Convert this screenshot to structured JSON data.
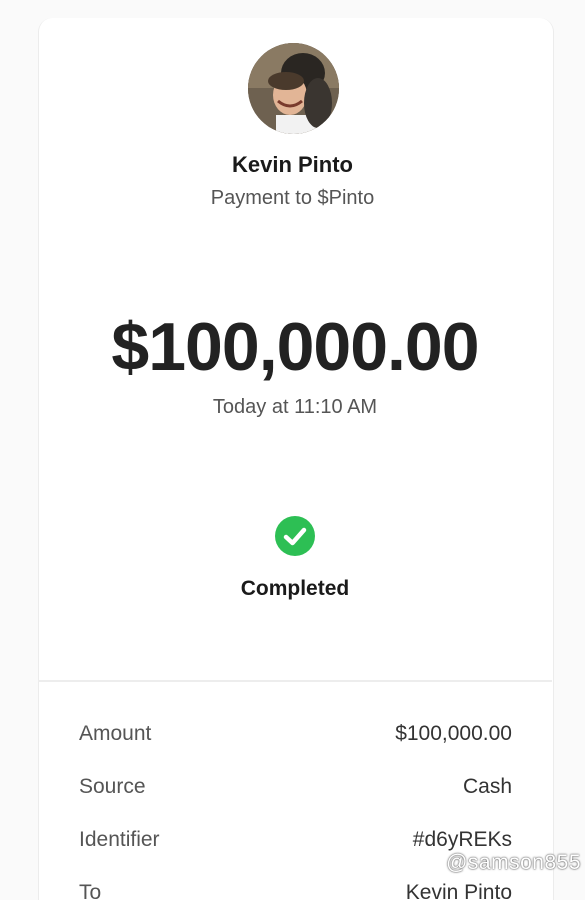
{
  "recipient": {
    "name": "Kevin Pinto",
    "subtitle": "Payment to $Pinto",
    "avatar_icon": "profile-photo"
  },
  "payment": {
    "amount": "$100,000.00",
    "timestamp": "Today at 11:10 AM",
    "status": "Completed",
    "status_icon": "check-circle-icon",
    "status_color": "#2dbf54"
  },
  "details": [
    {
      "label": "Amount",
      "value": "$100,000.00"
    },
    {
      "label": "Source",
      "value": "Cash"
    },
    {
      "label": "Identifier",
      "value": "#d6yREKs"
    },
    {
      "label": "To",
      "value": "Kevin Pinto"
    }
  ],
  "watermark": "@samson855"
}
